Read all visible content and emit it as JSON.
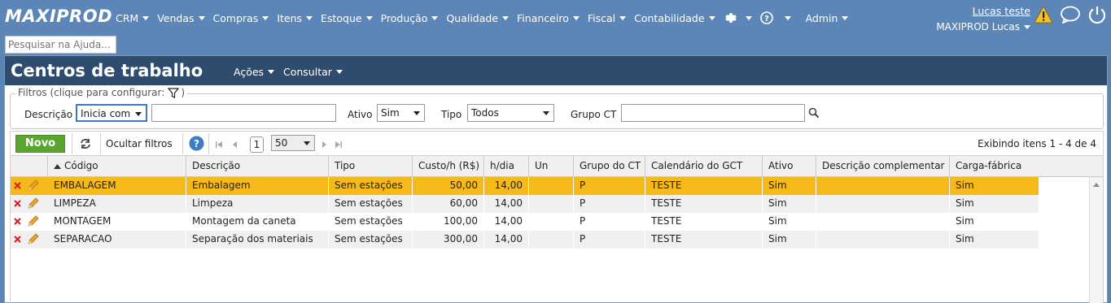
{
  "app": {
    "logo": "MAXIPROD",
    "menu": [
      "CRM",
      "Vendas",
      "Compras",
      "Itens",
      "Estoque",
      "Produção",
      "Qualidade",
      "Financeiro",
      "Fiscal",
      "Contabilidade"
    ],
    "admin_label": "Admin",
    "user_name": "Lucas teste",
    "company": "MAXIPROD Lucas",
    "help_placeholder": "Pesquisar na Ajuda..."
  },
  "page": {
    "title": "Centros de trabalho",
    "actions_label": "Ações",
    "consult_label": "Consultar"
  },
  "filters": {
    "legend": "Filtros (clique para configurar:",
    "legend_close": ")",
    "descricao_label": "Descrição",
    "descricao_mode": "Inicia com",
    "ativo_label": "Ativo",
    "ativo_value": "Sim",
    "tipo_label": "Tipo",
    "tipo_value": "Todos",
    "grupo_label": "Grupo CT"
  },
  "toolbar": {
    "novo_label": "Novo",
    "hide_filters_label": "Ocultar filtros",
    "page_number": "1",
    "per_page": "50",
    "range_text": "Exibindo itens 1 - 4 de 4"
  },
  "grid": {
    "columns": [
      "Código",
      "Descrição",
      "Tipo",
      "Custo/h (R$)",
      "h/dia",
      "Un",
      "Grupo do CT",
      "Calendário do GCT",
      "Ativo",
      "Descrição complementar",
      "Carga-fábrica"
    ],
    "rows": [
      [
        "EMBALAGEM",
        "Embalagem",
        "Sem estações",
        "50,00",
        "14,00",
        "",
        "P",
        "TESTE",
        "Sim",
        "",
        "Sim"
      ],
      [
        "LIMPEZA",
        "Limpeza",
        "Sem estações",
        "60,00",
        "14,00",
        "",
        "P",
        "TESTE",
        "Sim",
        "",
        "Sim"
      ],
      [
        "MONTAGEM",
        "Montagem da caneta",
        "Sem estações",
        "100,00",
        "14,00",
        "",
        "P",
        "TESTE",
        "Sim",
        "",
        "Sim"
      ],
      [
        "SEPARACAO",
        "Separação dos materiais",
        "Sem estações",
        "300,00",
        "14,00",
        "",
        "P",
        "TESTE",
        "Sim",
        "",
        "Sim"
      ]
    ]
  },
  "colors": {
    "nav_bg": "#5b86b7",
    "title_bar_bg": "#2e4d6e",
    "selected_row": "#f5b919",
    "novo_button": "#5aa52f"
  }
}
